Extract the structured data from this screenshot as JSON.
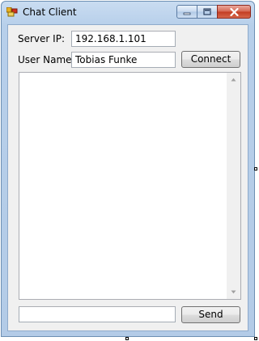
{
  "window": {
    "title": "Chat Client",
    "icons": {
      "app": "app-icon",
      "minimize": "minimize-icon",
      "maximize": "maximize-icon",
      "close": "close-icon"
    },
    "colors": {
      "close_button": "#c23b21",
      "frame": "#b7cfea",
      "client_bg": "#f0f0f0"
    }
  },
  "form": {
    "server_ip_label": "Server IP:",
    "server_ip_value": "192.168.1.101",
    "user_name_label": "User Name:",
    "user_name_value": "Tobias Funke",
    "connect_label": "Connect",
    "message_value": "",
    "send_label": "Send"
  },
  "chat": {
    "messages": [],
    "scroll_up_icon": "scroll-up-arrow-icon",
    "scroll_down_icon": "scroll-down-arrow-icon"
  }
}
